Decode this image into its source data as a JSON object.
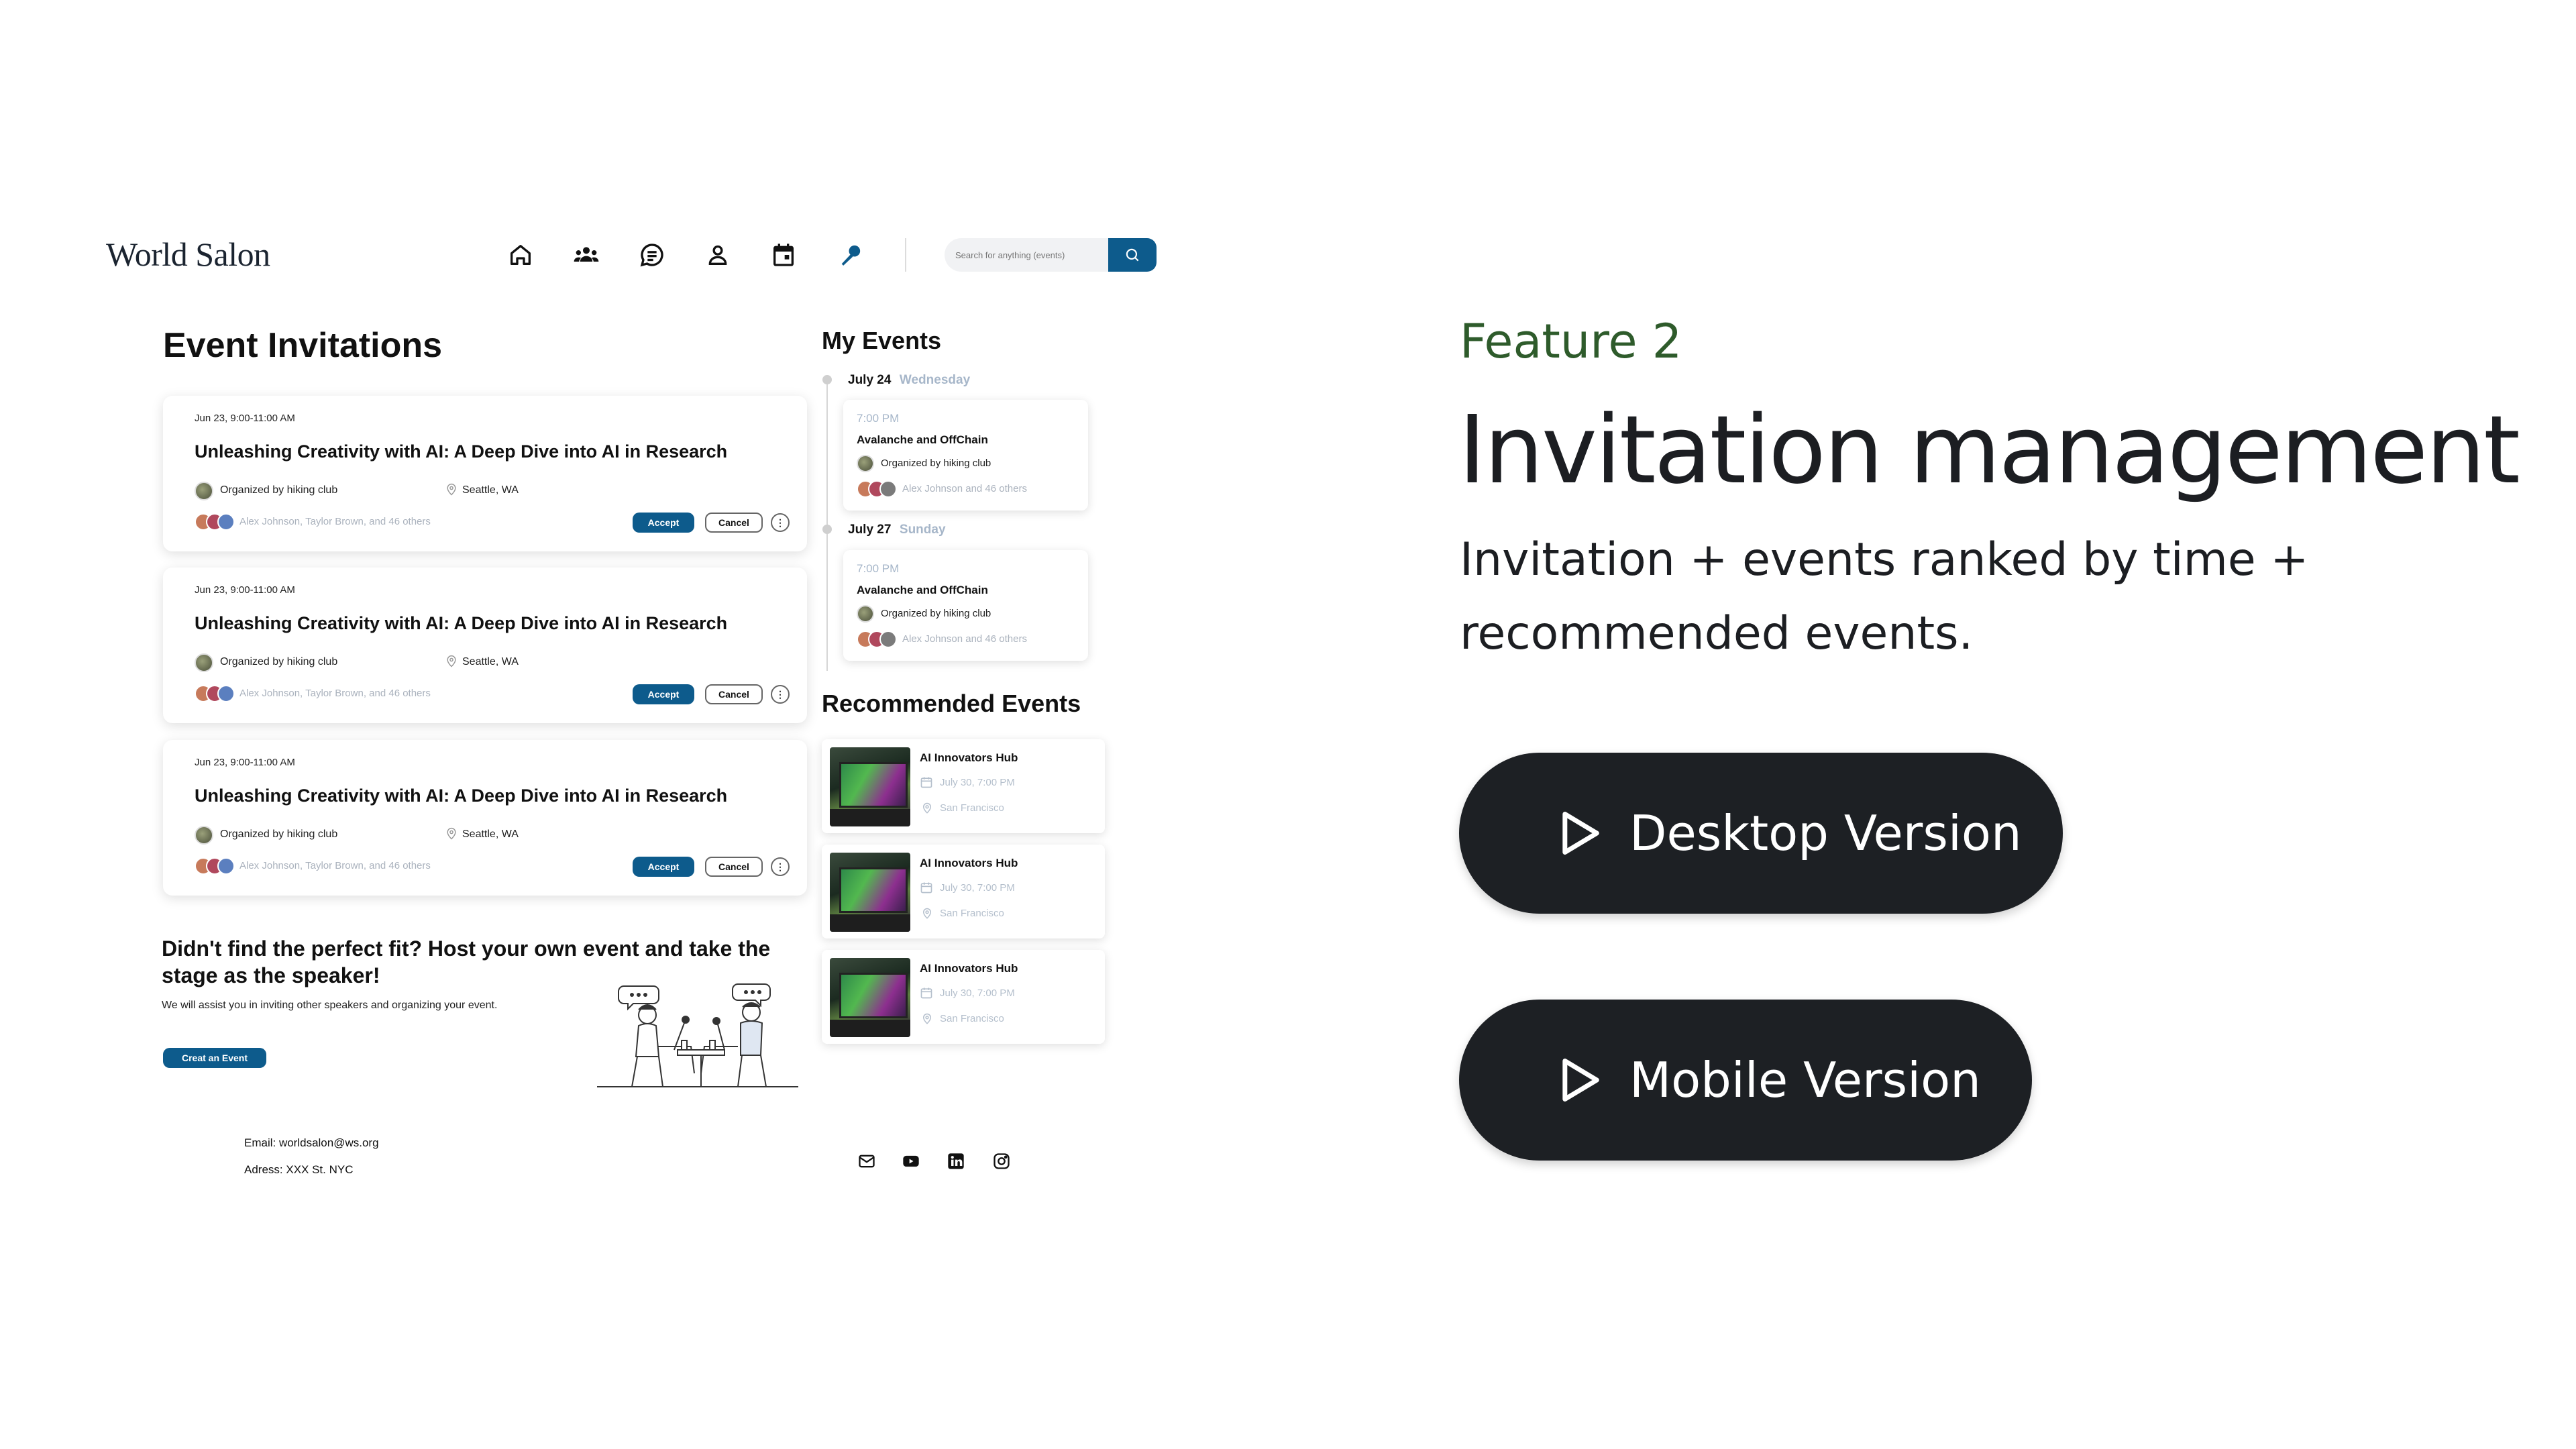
{
  "header": {
    "logo": "World Salon",
    "nav_icons": [
      "home-icon",
      "groups-icon",
      "chat-icon",
      "profile-icon",
      "calendar-icon",
      "microphone-icon"
    ],
    "search_placeholder": "Search for anything (events)"
  },
  "invitations": {
    "title": "Event Invitations",
    "cards": [
      {
        "date": "Jun 23, 9:00-11:00 AM",
        "title": "Unleashing Creativity with AI: A Deep Dive into AI in Research",
        "organizer": "Organized by hiking club",
        "location": "Seattle, WA",
        "attendees": "Alex Johnson, Taylor Brown, and 46 others",
        "accept": "Accept",
        "cancel": "Cancel"
      },
      {
        "date": "Jun 23, 9:00-11:00 AM",
        "title": "Unleashing Creativity with AI: A Deep Dive into AI in Research",
        "organizer": "Organized by hiking club",
        "location": "Seattle, WA",
        "attendees": "Alex Johnson, Taylor Brown, and 46 others",
        "accept": "Accept",
        "cancel": "Cancel"
      },
      {
        "date": "Jun 23, 9:00-11:00 AM",
        "title": "Unleashing Creativity with AI: A Deep Dive into AI in Research",
        "organizer": "Organized by hiking club",
        "location": "Seattle, WA",
        "attendees": "Alex Johnson, Taylor Brown, and 46 others",
        "accept": "Accept",
        "cancel": "Cancel"
      }
    ]
  },
  "host": {
    "title": "Didn't find the perfect fit? Host your own event and take the stage as the speaker!",
    "subtitle": "We will assist you in inviting other speakers and organizing your event.",
    "button": "Creat an Event"
  },
  "my_events": {
    "title": "My Events",
    "days": [
      {
        "date": "July 24",
        "weekday": "Wednesday",
        "time": "7:00 PM",
        "name": "Avalanche and OffChain",
        "organizer": "Organized by hiking club",
        "attendees": "Alex Johnson and 46 others"
      },
      {
        "date": "July 27",
        "weekday": "Sunday",
        "time": "7:00 PM",
        "name": "Avalanche and OffChain",
        "organizer": "Organized by hiking club",
        "attendees": "Alex Johnson and 46 others"
      }
    ]
  },
  "recommended": {
    "title": "Recommended Events",
    "items": [
      {
        "name": "AI Innovators Hub",
        "date": "July 30, 7:00 PM",
        "location": "San Francisco"
      },
      {
        "name": "AI Innovators Hub",
        "date": "July 30, 7:00 PM",
        "location": "San Francisco"
      },
      {
        "name": "AI Innovators Hub",
        "date": "July 30, 7:00 PM",
        "location": "San Francisco"
      }
    ]
  },
  "footer": {
    "email": "Email: worldsalon@ws.org",
    "address": "Adress: XXX St. NYC",
    "social_icons": [
      "mail-icon",
      "youtube-icon",
      "linkedin-icon",
      "instagram-icon"
    ]
  },
  "feature": {
    "label": "Feature 2",
    "title": "Invitation management",
    "description": "Invitation + events ranked by time + recommended events.",
    "desktop_button": "Desktop Version",
    "mobile_button": "Mobile Version"
  },
  "colors": {
    "primary_blue": "#0d5b8c",
    "feature_green": "#2e5b2b",
    "dark_button": "#1d2024",
    "muted_text": "#aab2bd"
  }
}
